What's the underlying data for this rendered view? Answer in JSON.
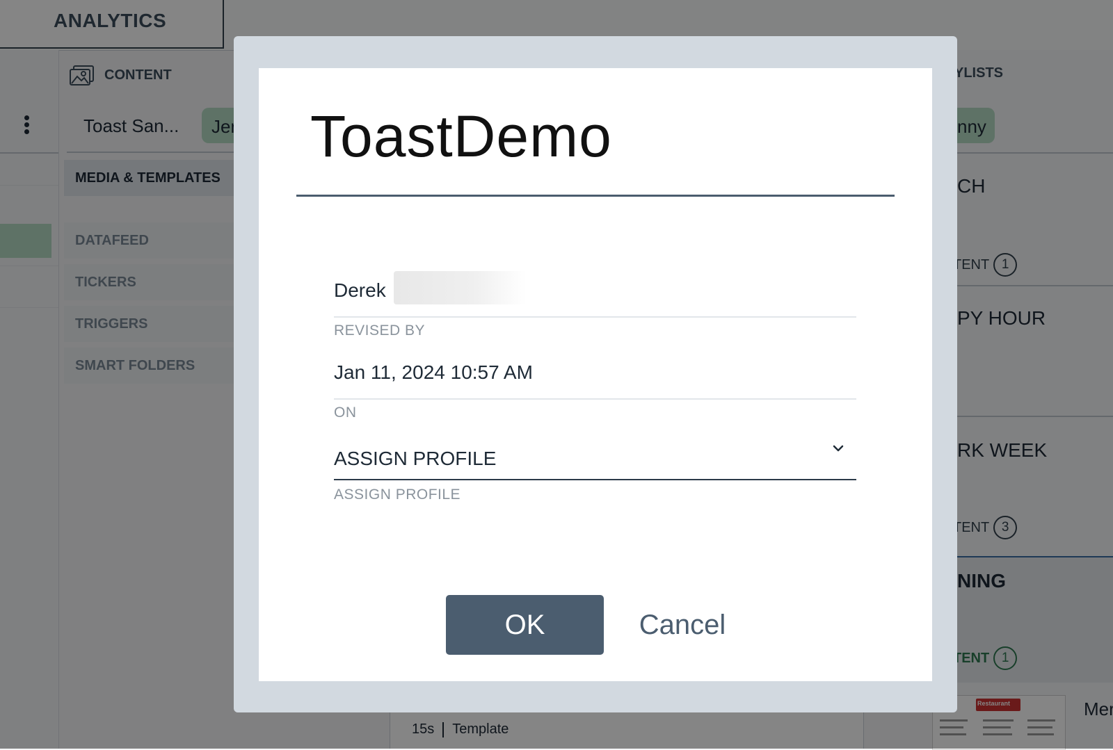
{
  "app": {
    "tab_analytics": "ANALYTICS",
    "content_header": "CONTENT",
    "search_value": "Toast San...",
    "filter_chip": "Jer",
    "nav": [
      {
        "label": "MEDIA & TEMPLATES"
      },
      {
        "label": "DATAFEED"
      },
      {
        "label": "TICKERS"
      },
      {
        "label": "TRIGGERS"
      },
      {
        "label": "SMART FOLDERS"
      }
    ],
    "bottom_duration": "15s",
    "bottom_type": "Template",
    "right": {
      "header": "YLISTS",
      "chip": "nny",
      "playlists": [
        {
          "title": "CH",
          "count_label": "TENT",
          "count": "1"
        },
        {
          "title": "PY HOUR"
        },
        {
          "title": "RK WEEK",
          "count_label": "TENT",
          "count": "3"
        },
        {
          "title": "NING",
          "count_label": "TENT",
          "count": "1"
        }
      ],
      "thumb_text": "Mer",
      "thumb_banner": "Restaurant"
    }
  },
  "dialog": {
    "title": "ToastDemo",
    "revised_by_value": "Derek",
    "revised_by_label": "REVISED BY",
    "on_value": "Jan 11, 2024 10:57 AM",
    "on_label": "ON",
    "profile_select_value": "ASSIGN PROFILE",
    "profile_label": "ASSIGN PROFILE",
    "ok_label": "OK",
    "cancel_label": "Cancel"
  },
  "colors": {
    "primary": "#4b5d6f",
    "accent_green": "#b4dbc4",
    "overlay": "rgba(0,0,0,0.48)"
  },
  "icons": [
    "kebab-menu-icon",
    "image-gallery-icon",
    "chevron-down-icon"
  ]
}
